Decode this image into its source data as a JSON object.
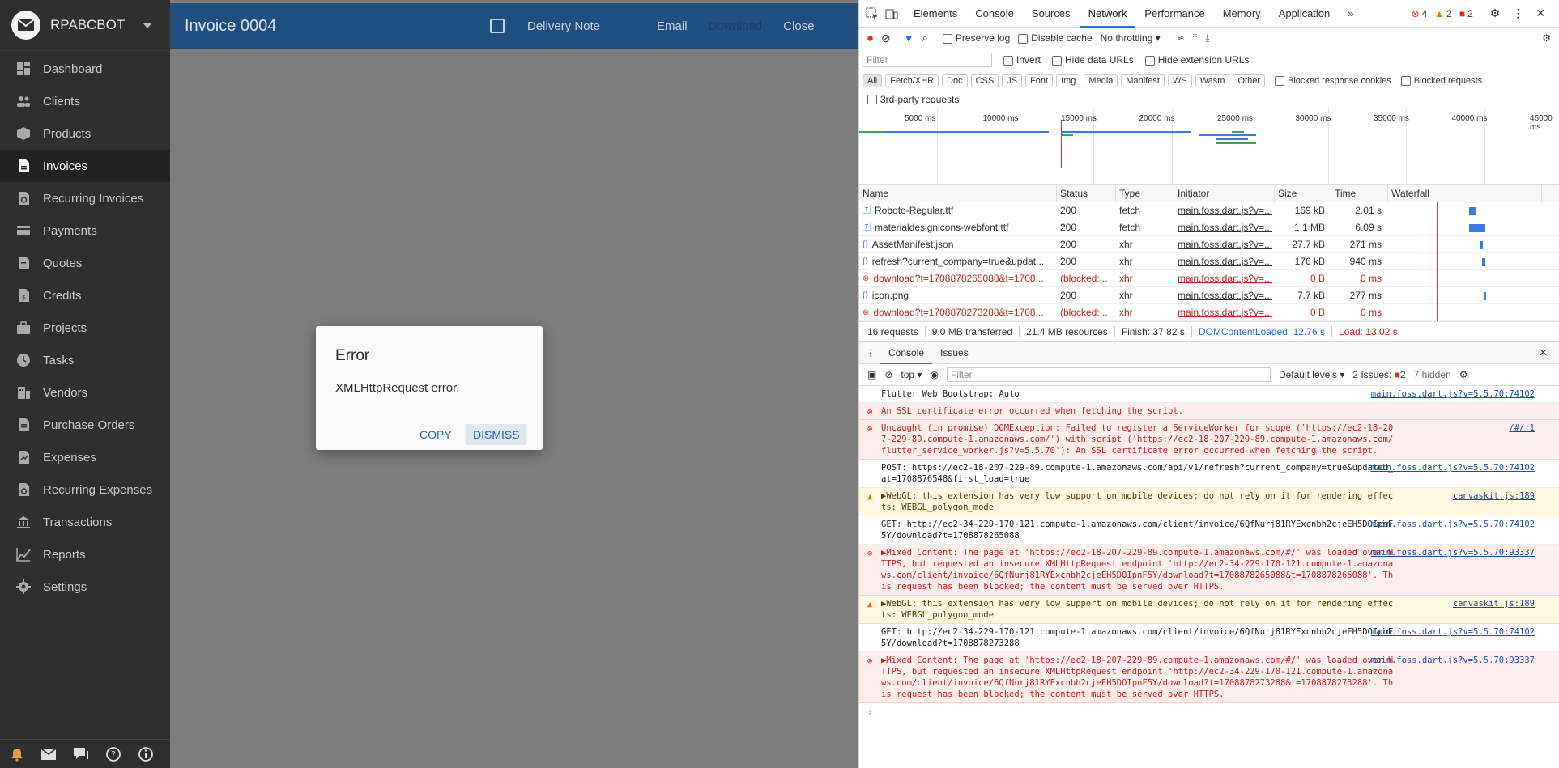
{
  "app": {
    "brand": "RPABCBOT",
    "nav": [
      {
        "label": "Dashboard",
        "icon": "dashboard-icon"
      },
      {
        "label": "Clients",
        "icon": "clients-icon"
      },
      {
        "label": "Products",
        "icon": "products-icon"
      },
      {
        "label": "Invoices",
        "icon": "invoices-icon",
        "active": true
      },
      {
        "label": "Recurring Invoices",
        "icon": "recurring-invoices-icon"
      },
      {
        "label": "Payments",
        "icon": "payments-icon"
      },
      {
        "label": "Quotes",
        "icon": "quotes-icon"
      },
      {
        "label": "Credits",
        "icon": "credits-icon"
      },
      {
        "label": "Projects",
        "icon": "projects-icon"
      },
      {
        "label": "Tasks",
        "icon": "tasks-icon"
      },
      {
        "label": "Vendors",
        "icon": "vendors-icon"
      },
      {
        "label": "Purchase Orders",
        "icon": "purchase-orders-icon"
      },
      {
        "label": "Expenses",
        "icon": "expenses-icon"
      },
      {
        "label": "Recurring Expenses",
        "icon": "recurring-expenses-icon"
      },
      {
        "label": "Transactions",
        "icon": "transactions-icon"
      },
      {
        "label": "Reports",
        "icon": "reports-icon"
      },
      {
        "label": "Settings",
        "icon": "settings-icon"
      }
    ],
    "topbar": {
      "title": "Invoice 0004",
      "delivery_note": "Delivery Note",
      "email": "Email",
      "download": "Download",
      "close": "Close"
    },
    "dialog": {
      "title": "Error",
      "message": "XMLHttpRequest error.",
      "copy": "COPY",
      "dismiss": "DISMISS"
    }
  },
  "devtools": {
    "tabs": [
      "Elements",
      "Console",
      "Sources",
      "Network",
      "Performance",
      "Memory",
      "Application"
    ],
    "active_tab": "Network",
    "badges": {
      "errors": "4",
      "warnings": "2",
      "issues": "2"
    },
    "toolbar": {
      "preserve_log": "Preserve log",
      "disable_cache": "Disable cache",
      "throttling": "No throttling"
    },
    "filter": {
      "placeholder": "Filter",
      "invert": "Invert",
      "hide_data": "Hide data URLs",
      "hide_ext": "Hide extension URLs"
    },
    "types": [
      "All",
      "Fetch/XHR",
      "Doc",
      "CSS",
      "JS",
      "Font",
      "Img",
      "Media",
      "Manifest",
      "WS",
      "Wasm",
      "Other"
    ],
    "blocked_cookies": "Blocked response cookies",
    "blocked_requests": "Blocked requests",
    "third_party": "3rd-party requests",
    "timeline_labels": [
      "5000 ms",
      "10000 ms",
      "15000 ms",
      "20000 ms",
      "25000 ms",
      "30000 ms",
      "35000 ms",
      "40000 ms",
      "45000 ms"
    ],
    "columns": [
      "Name",
      "Status",
      "Type",
      "Initiator",
      "Size",
      "Time",
      "Waterfall"
    ],
    "requests": [
      {
        "name": "Roboto-Regular.ttf",
        "status": "200",
        "type": "fetch",
        "initiator": "main.foss.dart.js?v=...",
        "size": "169 kB",
        "time": "2.01 s",
        "err": false
      },
      {
        "name": "materialdesignicons-webfont.ttf",
        "status": "200",
        "type": "fetch",
        "initiator": "main.foss.dart.js?v=...",
        "size": "1.1 MB",
        "time": "6.09 s",
        "err": false
      },
      {
        "name": "AssetManifest.json",
        "status": "200",
        "type": "xhr",
        "initiator": "main.foss.dart.js?v=...",
        "size": "27.7 kB",
        "time": "271 ms",
        "err": false
      },
      {
        "name": "refresh?current_company=true&updat...",
        "status": "200",
        "type": "xhr",
        "initiator": "main.foss.dart.js?v=...",
        "size": "176 kB",
        "time": "940 ms",
        "err": false
      },
      {
        "name": "download?t=1708878265088&t=1708...",
        "status": "(blocked:...",
        "type": "xhr",
        "initiator": "main.foss.dart.js?v=...",
        "size": "0 B",
        "time": "0 ms",
        "err": true
      },
      {
        "name": "icon.png",
        "status": "200",
        "type": "xhr",
        "initiator": "main.foss.dart.js?v=...",
        "size": "7.7 kB",
        "time": "277 ms",
        "err": false
      },
      {
        "name": "download?t=1708878273288&t=1708...",
        "status": "(blocked:...",
        "type": "xhr",
        "initiator": "main.foss.dart.js?v=...",
        "size": "0 B",
        "time": "0 ms",
        "err": true
      }
    ],
    "summary": [
      "16 requests",
      "9.0 MB transferred",
      "21.4 MB resources",
      "Finish: 37.82 s",
      "DOMContentLoaded: 12.76 s",
      "Load: 13.02 s"
    ],
    "console_tabs": [
      "Console",
      "Issues"
    ],
    "console_toolbar": {
      "context": "top",
      "filter": "Filter",
      "levels": "Default levels",
      "issues": "2 Issues:",
      "issues_count": "2",
      "hidden": "7 hidden"
    },
    "logs": [
      {
        "level": "info",
        "text": "Flutter Web Bootstrap: Auto",
        "src": "main.foss.dart.js?v=5.5.70:74102"
      },
      {
        "level": "error",
        "text": "An SSL certificate error occurred when fetching the script.",
        "src": ""
      },
      {
        "level": "error",
        "text": "Uncaught (in promise) DOMException: Failed to register a ServiceWorker for scope ('https://ec2-18-207-229-89.compute-1.amazonaws.com/') with script ('https://ec2-18-207-229-89.compute-1.amazonaws.com/flutter_service_worker.js?v=5.5.70'): An SSL certificate error occurred when fetching the script.",
        "src": "/#/:1"
      },
      {
        "level": "info",
        "text": "POST: https://ec2-18-207-229-89.compute-1.amazonaws.com/api/v1/refresh?current_company=true&updated_at=1708876548&first_load=true",
        "src": "main.foss.dart.js?v=5.5.70:74102"
      },
      {
        "level": "warn",
        "text": "▶WebGL: this extension has very low support on mobile devices; do not rely on it for rendering effects: WEBGL_polygon_mode",
        "src": "canvaskit.js:189"
      },
      {
        "level": "info",
        "text": "GET: http://ec2-34-229-170-121.compute-1.amazonaws.com/client/invoice/6QfNurj81RYExcnbh2cjeEH5DOIpnF5Y/download?t=1708878265088",
        "src": "main.foss.dart.js?v=5.5.70:74102"
      },
      {
        "level": "error",
        "text": "▶Mixed Content: The page at 'https://ec2-18-207-229-89.compute-1.amazonaws.com/#/' was loaded over HTTPS, but requested an insecure XMLHttpRequest endpoint 'http://ec2-34-229-170-121.compute-1.amazonaws.com/client/invoice/6QfNurj81RYExcnbh2cjeEH5DOIpnF5Y/download?t=1708878265088&t=1708878265088'. This request has been blocked; the content must be served over HTTPS.",
        "src": "main.foss.dart.js?v=5.5.70:93337"
      },
      {
        "level": "warn",
        "text": "▶WebGL: this extension has very low support on mobile devices; do not rely on it for rendering effects: WEBGL_polygon_mode",
        "src": "canvaskit.js:189"
      },
      {
        "level": "info",
        "text": "GET: http://ec2-34-229-170-121.compute-1.amazonaws.com/client/invoice/6QfNurj81RYExcnbh2cjeEH5DOIpnF5Y/download?t=1708878273288",
        "src": "main.foss.dart.js?v=5.5.70:74102"
      },
      {
        "level": "error",
        "text": "▶Mixed Content: The page at 'https://ec2-18-207-229-89.compute-1.amazonaws.com/#/' was loaded over HTTPS, but requested an insecure XMLHttpRequest endpoint 'http://ec2-34-229-170-121.compute-1.amazonaws.com/client/invoice/6QfNurj81RYExcnbh2cjeEH5DOIpnF5Y/download?t=1708878273288&t=1708878273288'. This request has been blocked; the content must be served over HTTPS.",
        "src": "main.foss.dart.js?v=5.5.70:93337"
      }
    ]
  }
}
